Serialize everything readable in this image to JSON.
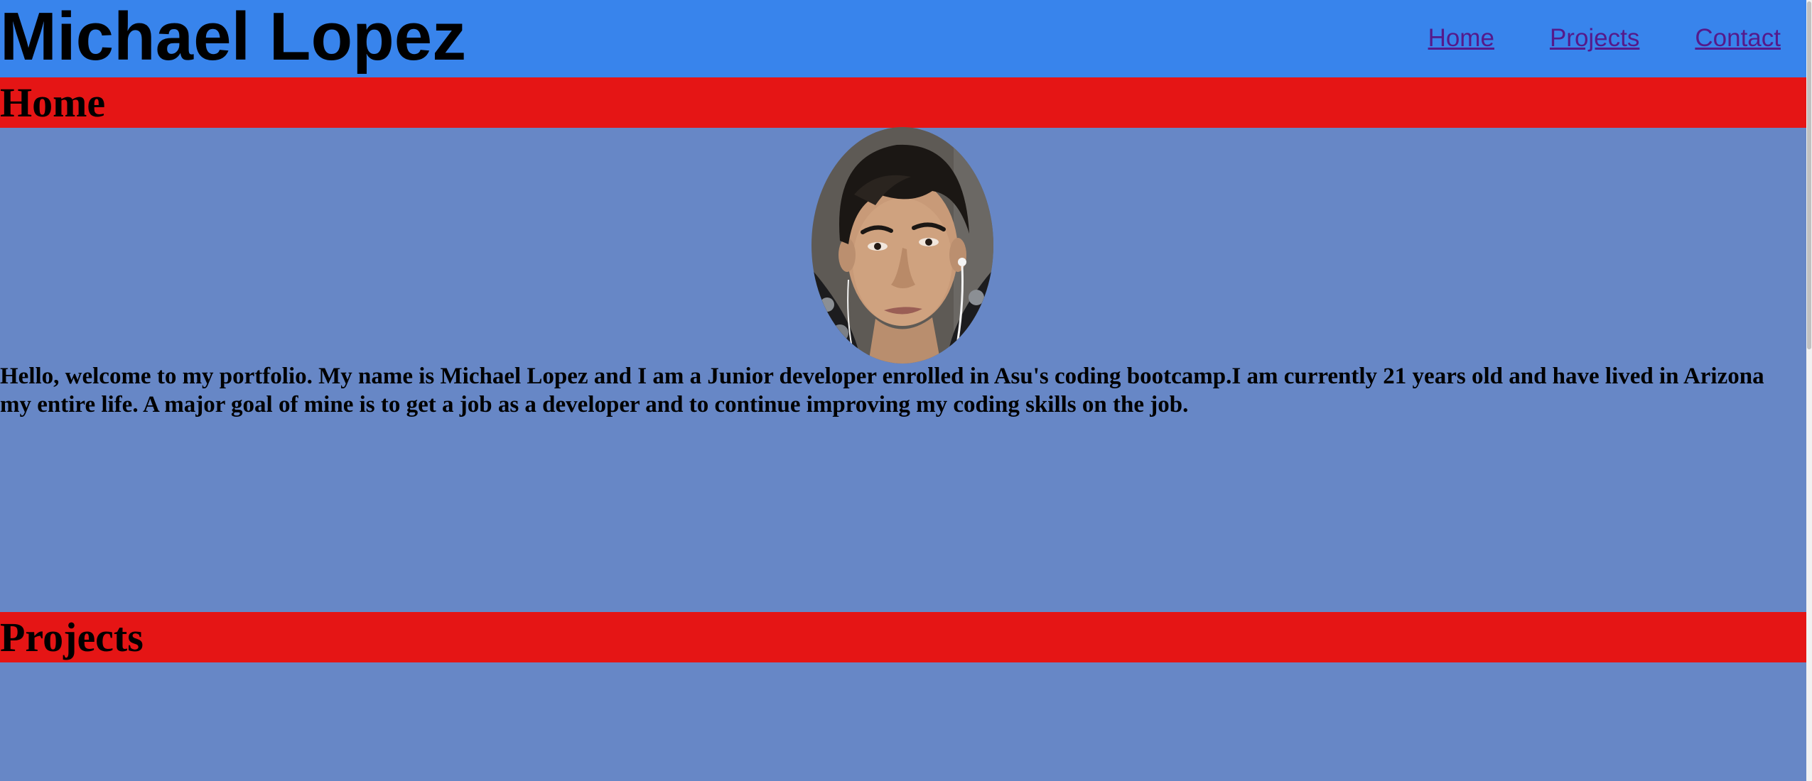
{
  "header": {
    "title": "Michael Lopez",
    "nav": [
      {
        "label": "Home"
      },
      {
        "label": "Projects"
      },
      {
        "label": "Contact"
      }
    ]
  },
  "sections": {
    "home": {
      "heading": "Home",
      "bio": "Hello, welcome to my portfolio. My name is Michael Lopez and I am a Junior developer enrolled in Asu's coding bootcamp.I am currently 21 years old and have lived in Arizona my entire life. A major goal of mine is to get a job as a developer and to continue improving my coding skills on the job."
    },
    "projects": {
      "heading": "Projects"
    }
  },
  "colors": {
    "header_bg": "#3884ec",
    "section_header_bg": "#e51515",
    "page_bg": "#6787c6",
    "link": "#551a8b"
  }
}
